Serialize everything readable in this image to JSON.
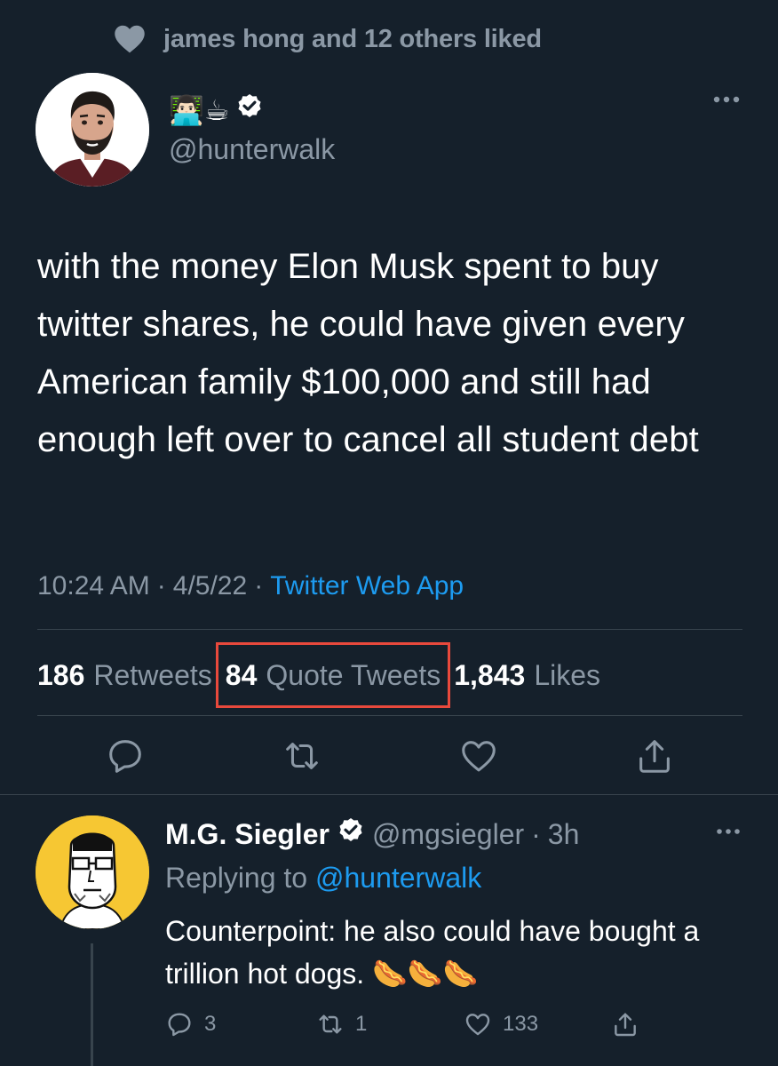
{
  "liked_by": {
    "text": "james hong and 12 others liked"
  },
  "main_tweet": {
    "author_emoji": "👨🏻‍💻☕",
    "handle": "@hunterwalk",
    "text": "with the money Elon Musk spent to buy twitter shares, he could have given every American family $100,000 and still had enough left over to cancel all student debt",
    "time": "10:24 AM",
    "date": "4/5/22",
    "separator": "·",
    "source": "Twitter Web App",
    "stats": {
      "retweets_count": "186",
      "retweets_label": "Retweets",
      "quotes_count": "84",
      "quotes_label": "Quote Tweets",
      "likes_count": "1,843",
      "likes_label": "Likes"
    },
    "actions": [
      "reply-icon",
      "retweet-icon",
      "like-icon",
      "share-icon"
    ]
  },
  "reply_tweet": {
    "name": "M.G. Siegler",
    "handle": "@mgsiegler",
    "separator": "·",
    "time": "3h",
    "replying_prefix": "Replying to",
    "replying_handle": "@hunterwalk",
    "text": "Counterpoint: he also could have bought a trillion hot dogs. 🌭🌭🌭",
    "reply_count": "3",
    "retweet_count": "1",
    "like_count": "133"
  },
  "colors": {
    "background": "#15202b",
    "secondary_text": "#8b98a5",
    "link": "#1d9bf0",
    "divider": "#38444d",
    "highlight_box": "#e8493c"
  }
}
